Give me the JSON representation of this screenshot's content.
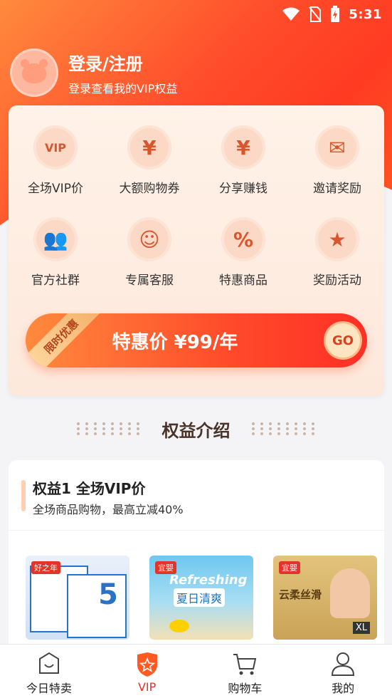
{
  "status": {
    "time": "5:31"
  },
  "profile": {
    "title": "登录/注册",
    "subtitle": "登录查看我的VIP权益"
  },
  "perks": [
    {
      "label": "全场VIP价",
      "icon": "vip-tag-icon",
      "glyph": "VIP"
    },
    {
      "label": "大额购物券",
      "icon": "coupon-icon",
      "glyph": "¥"
    },
    {
      "label": "分享赚钱",
      "icon": "money-bag-icon",
      "glyph": "¥"
    },
    {
      "label": "邀请奖励",
      "icon": "red-envelope-icon",
      "glyph": "✉"
    },
    {
      "label": "官方社群",
      "icon": "group-icon",
      "glyph": "👥"
    },
    {
      "label": "专属客服",
      "icon": "headset-icon",
      "glyph": "☺"
    },
    {
      "label": "特惠商品",
      "icon": "discount-icon",
      "glyph": "%"
    },
    {
      "label": "奖励活动",
      "icon": "medal-icon",
      "glyph": "★"
    }
  ],
  "promo": {
    "ribbon": "限时优惠",
    "text": "特惠价 ¥99/年",
    "go": "GO"
  },
  "section": {
    "title": "权益介绍"
  },
  "benefit": {
    "title": "权益1 全场VIP价",
    "subtitle": "全场商品购物，最高立减40%"
  },
  "products": [
    {
      "brand": "好之年",
      "badge": "5"
    },
    {
      "brand": "宜婴",
      "title": "Refreshing",
      "subtitle": "夏日清爽"
    },
    {
      "brand": "宜婴",
      "title": "云柔丝滑",
      "size": "XL"
    }
  ],
  "tabs": [
    {
      "label": "今日特卖",
      "icon": "bag-icon"
    },
    {
      "label": "VIP",
      "icon": "vip-shield-icon",
      "active": true
    },
    {
      "label": "购物车",
      "icon": "cart-icon"
    },
    {
      "label": "我的",
      "icon": "person-icon"
    }
  ],
  "colors": {
    "accent": "#ff4d2b",
    "tab_active": "#e2342a"
  }
}
